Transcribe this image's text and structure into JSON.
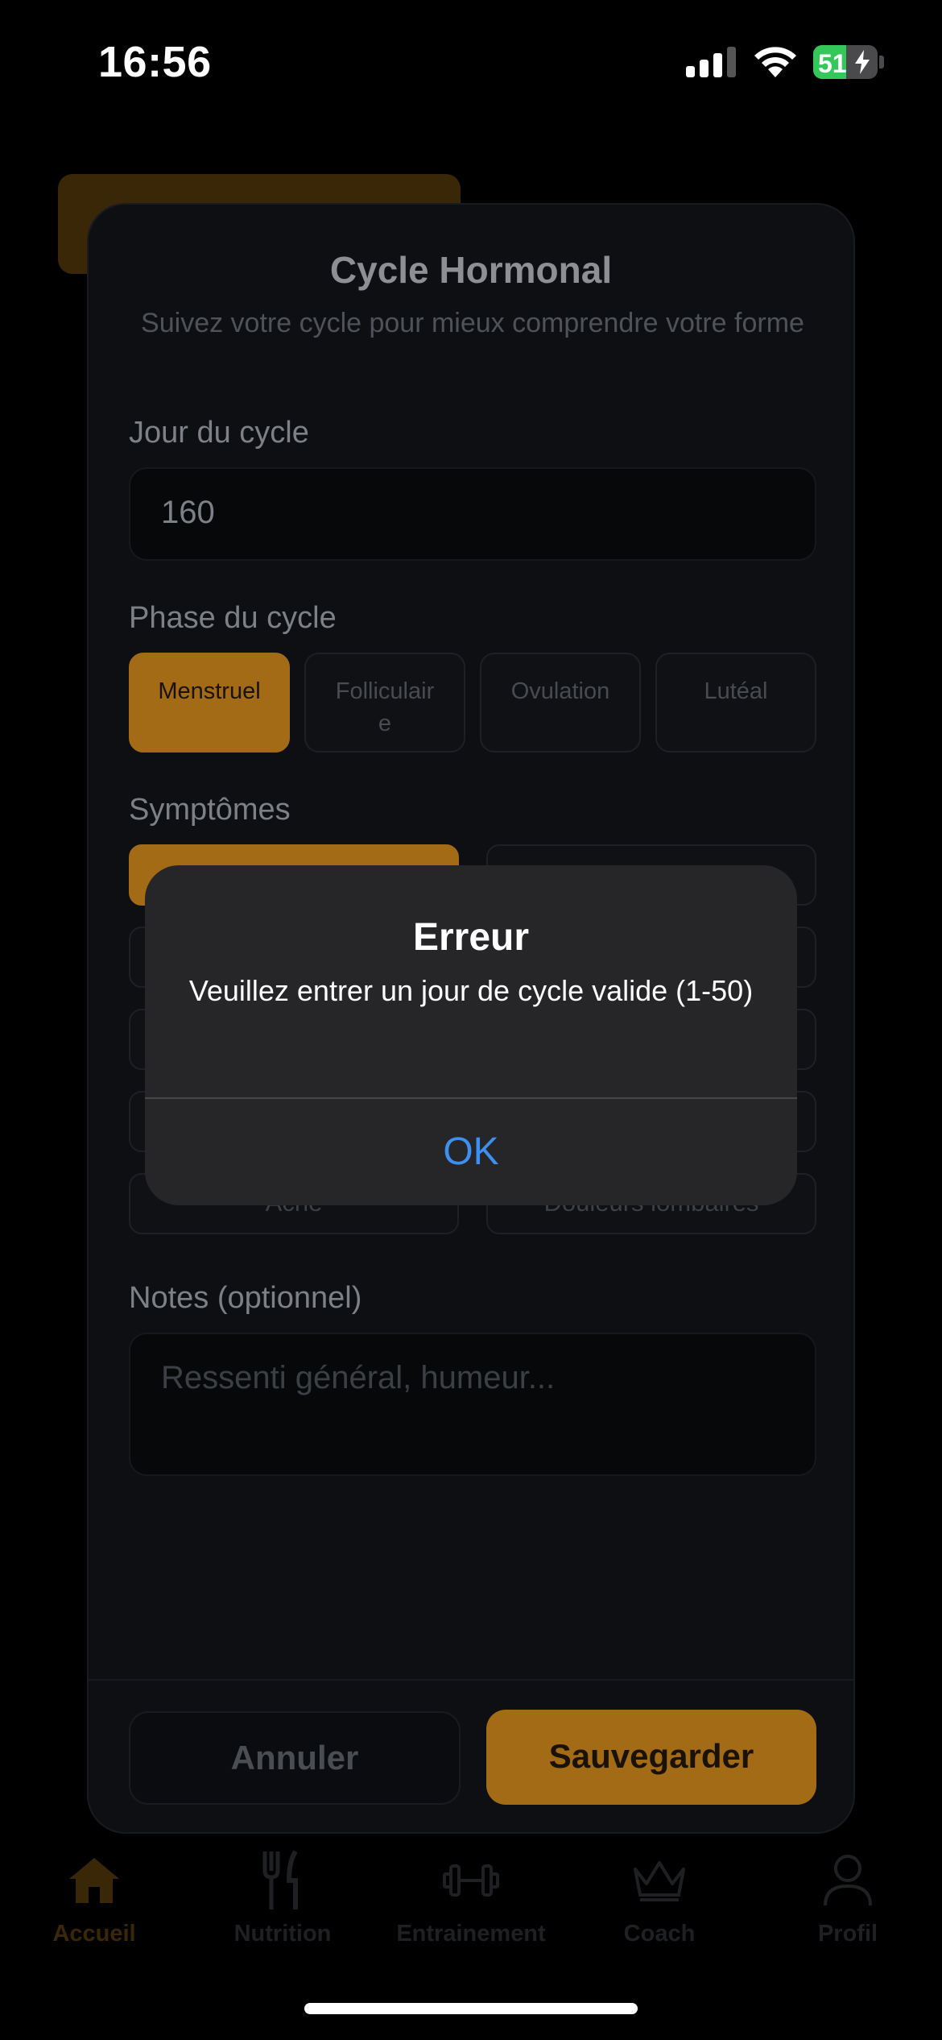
{
  "status_bar": {
    "time": "16:56",
    "battery": "51",
    "battery_percent": 51
  },
  "modal": {
    "title": "Cycle Hormonal",
    "subtitle": "Suivez votre cycle pour mieux comprendre votre forme",
    "cycle_day": {
      "label": "Jour du cycle",
      "value": "160"
    },
    "phase": {
      "label": "Phase du cycle",
      "options": [
        "Menstruel",
        "Folliculaire",
        "Ovulation",
        "Lutéal"
      ],
      "selected": "Menstruel"
    },
    "symptoms": {
      "label": "Symptômes",
      "items": [
        "",
        "",
        "",
        "",
        "",
        "",
        "",
        "",
        "Acné",
        "Douleurs lombaires"
      ]
    },
    "notes": {
      "label": "Notes (optionnel)",
      "placeholder": "Ressenti général, humeur..."
    },
    "cancel_label": "Annuler",
    "save_label": "Sauvegarder"
  },
  "alert": {
    "title": "Erreur",
    "message": "Veuillez entrer un jour de cycle valide (1-50)",
    "ok_label": "OK"
  },
  "tabs": [
    {
      "label": "Accueil",
      "icon": "home-icon",
      "active": true
    },
    {
      "label": "Nutrition",
      "icon": "fork-knife-icon"
    },
    {
      "label": "Entrainement",
      "icon": "dumbbell-icon"
    },
    {
      "label": "Coach",
      "icon": "crown-icon"
    },
    {
      "label": "Profil",
      "icon": "person-icon"
    }
  ],
  "colors": {
    "accent": "#a36b16",
    "alert_button": "#3d8ff0",
    "battery": "#34c759"
  }
}
